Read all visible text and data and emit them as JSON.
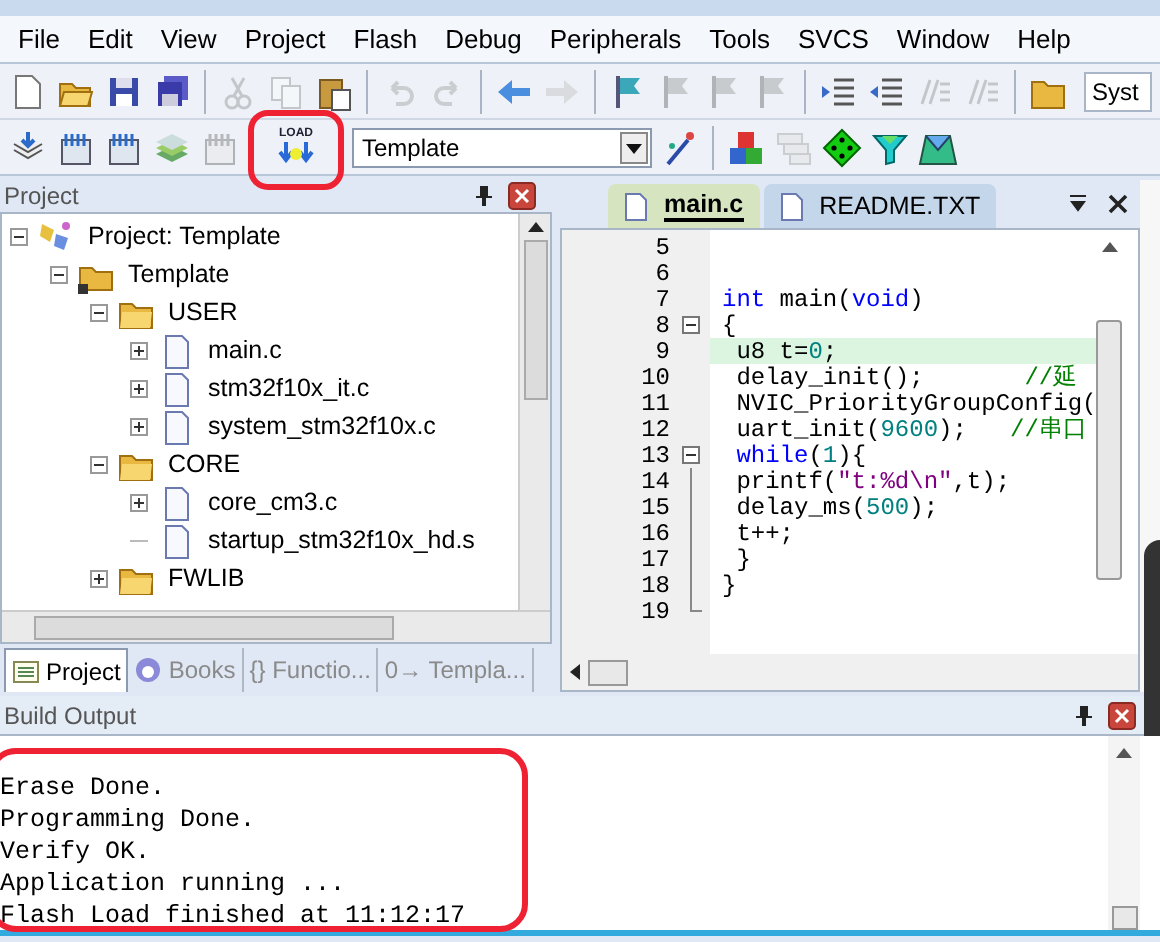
{
  "menu": [
    "File",
    "Edit",
    "View",
    "Project",
    "Flash",
    "Debug",
    "Peripherals",
    "Tools",
    "SVCS",
    "Window",
    "Help"
  ],
  "toolbar_1": [
    {
      "kind": "new",
      "disabled": false
    },
    {
      "kind": "open",
      "disabled": false
    },
    {
      "kind": "save",
      "disabled": false
    },
    {
      "kind": "saveall",
      "disabled": false
    },
    {
      "kind": "sep"
    },
    {
      "kind": "cut",
      "disabled": true
    },
    {
      "kind": "copy",
      "disabled": true
    },
    {
      "kind": "paste",
      "disabled": false
    },
    {
      "kind": "sep"
    },
    {
      "kind": "undo",
      "disabled": true
    },
    {
      "kind": "redo",
      "disabled": true
    },
    {
      "kind": "sep"
    },
    {
      "kind": "back",
      "disabled": false
    },
    {
      "kind": "forward",
      "disabled": true
    },
    {
      "kind": "sep"
    },
    {
      "kind": "bookmark",
      "disabled": false
    },
    {
      "kind": "bookmark",
      "disabled": true
    },
    {
      "kind": "bookmark",
      "disabled": true
    },
    {
      "kind": "bookmark",
      "disabled": true
    },
    {
      "kind": "sep"
    },
    {
      "kind": "indent",
      "disabled": false
    },
    {
      "kind": "unindent",
      "disabled": false
    },
    {
      "kind": "comment",
      "disabled": true
    },
    {
      "kind": "comment",
      "disabled": true
    },
    {
      "kind": "sep"
    },
    {
      "kind": "folder",
      "disabled": false
    }
  ],
  "search_field": {
    "value": "Syst"
  },
  "toolbar_2": [
    {
      "kind": "download",
      "disabled": false
    },
    {
      "kind": "build",
      "disabled": false
    },
    {
      "kind": "build",
      "disabled": false
    },
    {
      "kind": "layers",
      "disabled": false
    },
    {
      "kind": "build",
      "disabled": true
    },
    {
      "kind": "sep"
    },
    {
      "kind": "load",
      "label": "LOAD",
      "disabled": false,
      "annotated": true
    },
    {
      "kind": "sep"
    },
    {
      "kind": "target",
      "value": "Template"
    },
    {
      "kind": "wand",
      "disabled": false
    },
    {
      "kind": "sep"
    },
    {
      "kind": "blocks",
      "disabled": false
    },
    {
      "kind": "stack",
      "disabled": true
    },
    {
      "kind": "diamond",
      "disabled": false
    },
    {
      "kind": "funnel",
      "disabled": false
    },
    {
      "kind": "gems",
      "disabled": false
    }
  ],
  "project_panel": {
    "title": "Project",
    "tree": [
      {
        "kind": "project",
        "label": "Project: Template",
        "expanded": true,
        "children": [
          {
            "kind": "target",
            "label": "Template",
            "expanded": true,
            "children": [
              {
                "kind": "group",
                "label": "USER",
                "expanded": true,
                "children": [
                  {
                    "kind": "file",
                    "label": "main.c",
                    "expanded": false
                  },
                  {
                    "kind": "file",
                    "label": "stm32f10x_it.c",
                    "expanded": false
                  },
                  {
                    "kind": "file",
                    "label": "system_stm32f10x.c",
                    "expanded": false
                  }
                ]
              },
              {
                "kind": "group",
                "label": "CORE",
                "expanded": true,
                "children": [
                  {
                    "kind": "file",
                    "label": "core_cm3.c",
                    "expanded": false
                  },
                  {
                    "kind": "file",
                    "label": "startup_stm32f10x_hd.s"
                  }
                ]
              },
              {
                "kind": "group",
                "label": "FWLIB",
                "expanded": false
              }
            ]
          }
        ]
      }
    ],
    "tabs": [
      {
        "kind": "project",
        "label": "Project",
        "selected": true
      },
      {
        "kind": "books",
        "label": "Books",
        "selected": false
      },
      {
        "kind": "functions",
        "label": "{} Functio...",
        "selected": false
      },
      {
        "kind": "templates",
        "label": "0→ Templa...",
        "selected": false
      }
    ]
  },
  "editor": {
    "tabs": [
      {
        "label": "main.c",
        "selected": true
      },
      {
        "label": "README.TXT",
        "selected": false
      }
    ],
    "lines": [
      {
        "number": "5",
        "foldable": false
      },
      {
        "number": "6",
        "foldable": false
      },
      {
        "number": "7",
        "foldable": false,
        "tokens": [
          {
            "kind": "keyword",
            "text": "int"
          },
          {
            "kind": "plain",
            "text": " main("
          },
          {
            "kind": "keyword",
            "text": "void"
          },
          {
            "kind": "plain",
            "text": ")"
          }
        ]
      },
      {
        "number": "8",
        "foldable": true,
        "tokens": [
          {
            "kind": "plain",
            "text": "{"
          }
        ]
      },
      {
        "number": "9",
        "foldable": false,
        "current": true,
        "tokens": [
          {
            "kind": "plain",
            "text": " u8 t="
          },
          {
            "kind": "number",
            "text": "0"
          },
          {
            "kind": "plain",
            "text": ";"
          }
        ]
      },
      {
        "number": "10",
        "foldable": false,
        "tokens": [
          {
            "kind": "plain",
            "text": " delay_init();       "
          },
          {
            "kind": "comment",
            "text": "//延"
          }
        ]
      },
      {
        "number": "11",
        "foldable": false,
        "tokens": [
          {
            "kind": "plain",
            "text": " NVIC_PriorityGroupConfig("
          }
        ]
      },
      {
        "number": "12",
        "foldable": false,
        "tokens": [
          {
            "kind": "plain",
            "text": " uart_init("
          },
          {
            "kind": "number",
            "text": "9600"
          },
          {
            "kind": "plain",
            "text": ");   "
          },
          {
            "kind": "comment",
            "text": "//串口"
          }
        ]
      },
      {
        "number": "13",
        "foldable": true,
        "tokens": [
          {
            "kind": "keyword",
            "text": " while"
          },
          {
            "kind": "plain",
            "text": "("
          },
          {
            "kind": "number",
            "text": "1"
          },
          {
            "kind": "plain",
            "text": "){"
          }
        ]
      },
      {
        "number": "14",
        "foldable": false,
        "tokens": [
          {
            "kind": "plain",
            "text": " printf("
          },
          {
            "kind": "string",
            "text": "\"t:%d\\n\""
          },
          {
            "kind": "plain",
            "text": ",t);"
          }
        ]
      },
      {
        "number": "15",
        "foldable": false,
        "tokens": [
          {
            "kind": "plain",
            "text": " delay_ms("
          },
          {
            "kind": "number",
            "text": "500"
          },
          {
            "kind": "plain",
            "text": ");"
          }
        ]
      },
      {
        "number": "16",
        "foldable": false,
        "tokens": [
          {
            "kind": "plain",
            "text": " t++;"
          }
        ]
      },
      {
        "number": "17",
        "foldable": false,
        "tokens": [
          {
            "kind": "plain",
            "text": " }"
          }
        ]
      },
      {
        "number": "18",
        "foldable": false,
        "tokens": [
          {
            "kind": "plain",
            "text": "}"
          }
        ]
      },
      {
        "number": "19",
        "foldable": false
      }
    ]
  },
  "build_output": {
    "title": "Build Output",
    "lines": [
      "Erase Done.",
      "Programming Done.",
      "Verify OK.",
      "Application running ...",
      "Flash Load finished at 11:12:17"
    ],
    "annotated": true
  }
}
